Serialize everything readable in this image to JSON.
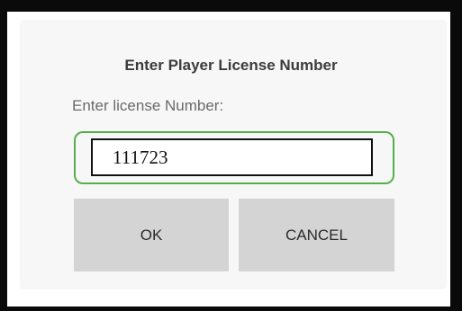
{
  "dialog": {
    "title": "Enter Player License Number",
    "prompt": "Enter license Number:",
    "input": {
      "value": "111723",
      "accent_color": "#56b04a"
    },
    "buttons": {
      "ok_label": "OK",
      "cancel_label": "CANCEL"
    }
  }
}
